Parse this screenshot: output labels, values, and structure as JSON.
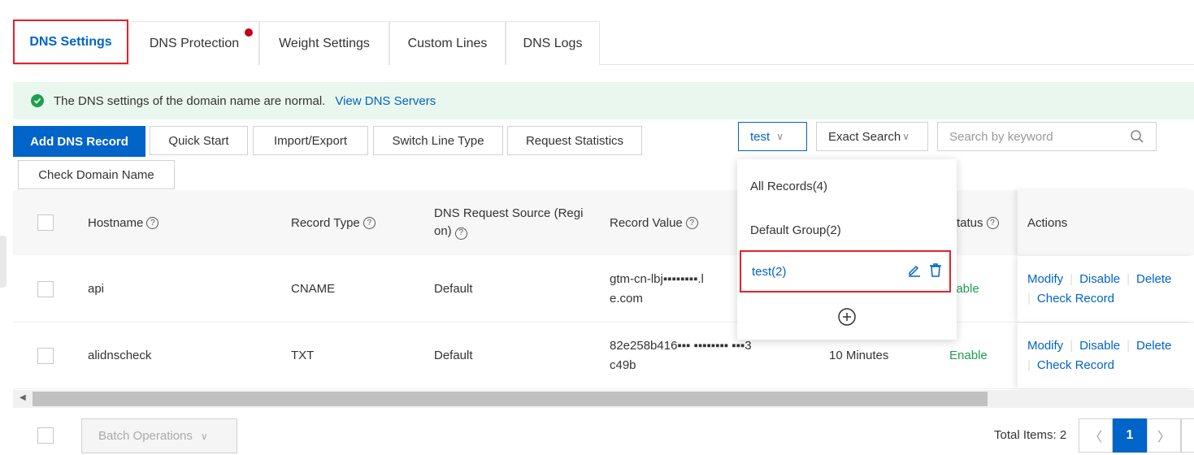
{
  "tabs": [
    {
      "label": "DNS Settings",
      "active": true
    },
    {
      "label": "DNS Protection",
      "badge": true
    },
    {
      "label": "Weight Settings"
    },
    {
      "label": "Custom Lines"
    },
    {
      "label": "DNS Logs"
    }
  ],
  "notice": {
    "text": "The DNS settings of the domain name are normal.",
    "link": "View DNS Servers"
  },
  "toolbar": {
    "add": "Add DNS Record",
    "quick_start": "Quick Start",
    "import_export": "Import/Export",
    "switch_line": "Switch Line Type",
    "request_stats": "Request Statistics",
    "check_domain": "Check Domain Name",
    "group_select": "test",
    "search_mode": "Exact Search",
    "search_placeholder": "Search by keyword"
  },
  "table": {
    "headers": {
      "hostname": "Hostname",
      "record_type": "Record Type",
      "source_line1": "DNS Request Source (Regi",
      "source_line2": "on)",
      "record_value": "Record Value",
      "status": "tatus",
      "actions": "Actions"
    },
    "rows": [
      {
        "hostname": "api",
        "type": "CNAME",
        "source": "Default",
        "value_line1": "gtm-cn-lbj▪▪▪▪▪▪▪▪.l",
        "value_line2": "e.com",
        "ttl": "",
        "status": "nable"
      },
      {
        "hostname": "alidnscheck",
        "type": "TXT",
        "source": "Default",
        "value_line1": "82e258b416▪▪▪ ▪▪▪▪▪▪▪▪ ▪▪▪3",
        "value_line2": "c49b",
        "ttl": "10 Minutes",
        "status": "Enable"
      }
    ],
    "actions": {
      "modify": "Modify",
      "disable": "Disable",
      "delete": "Delete",
      "check": "Check Record"
    }
  },
  "dropdown": {
    "items": [
      "All Records(4)",
      "Default Group(2)",
      "test(2)"
    ]
  },
  "footer": {
    "batch": "Batch Operations",
    "total": "Total Items: 2",
    "page": "1"
  },
  "colors": {
    "primary": "#0064c8",
    "success": "#1e9e52",
    "highlight": "#e8202a"
  }
}
